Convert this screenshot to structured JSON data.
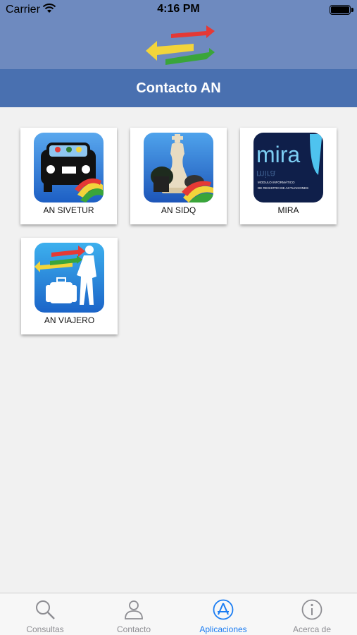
{
  "status_bar": {
    "carrier": "Carrier",
    "time": "4:16 PM"
  },
  "header": {
    "title": "Contacto AN"
  },
  "apps": [
    {
      "label": "AN SIVETUR",
      "icon": "car-icon"
    },
    {
      "label": "AN SIDQ",
      "icon": "chess-icon"
    },
    {
      "label": "MIRA",
      "icon": "mira-logo",
      "logo_text": "mira",
      "logo_sub1": "MODULO INFORMÁTICO",
      "logo_sub2": "DE REGISTRO DE ACTUACIONES"
    },
    {
      "label": "AN VIAJERO",
      "icon": "traveler-icon"
    }
  ],
  "tabbar": {
    "tabs": [
      {
        "label": "Consultas",
        "icon": "search-icon",
        "active": false
      },
      {
        "label": "Contacto",
        "icon": "person-icon",
        "active": false
      },
      {
        "label": "Aplicaciones",
        "icon": "app-store-icon",
        "active": true
      },
      {
        "label": "Acerca de",
        "icon": "info-icon",
        "active": false
      }
    ]
  },
  "colors": {
    "header_blue": "#4970b0",
    "top_blue": "#6e8abf",
    "accent": "#1a7cf2"
  }
}
